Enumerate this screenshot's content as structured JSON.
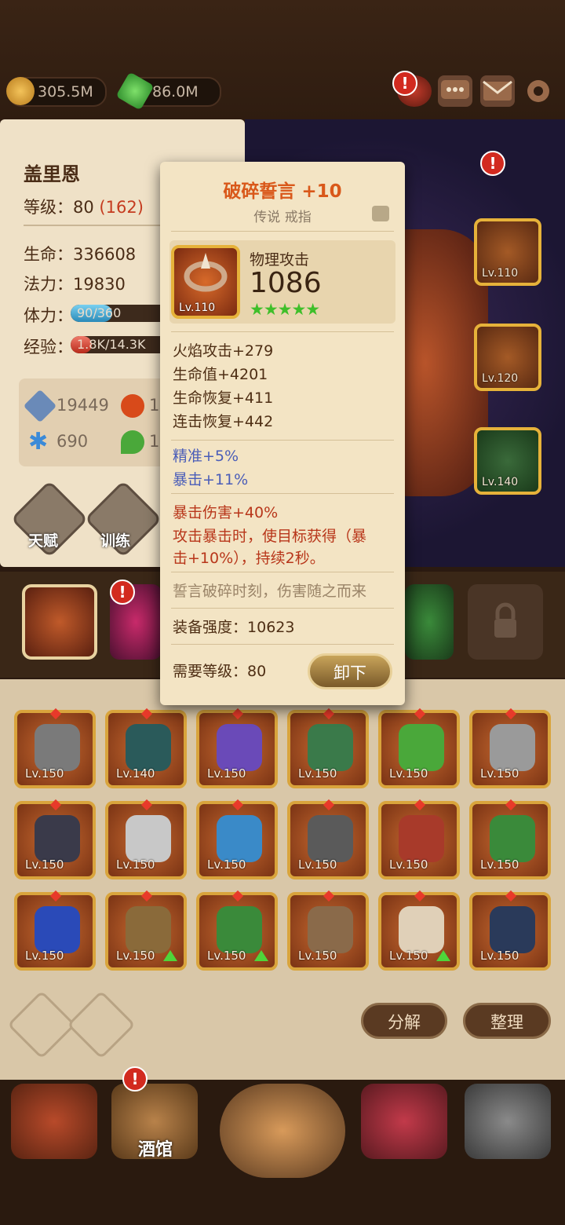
{
  "resources": {
    "coins": "305.5M",
    "gems": "86.0M"
  },
  "hero": {
    "name": "盖里恩",
    "level_label": "等级：",
    "level_value": "80",
    "level_extra": "(162)",
    "hp_label": "生命：",
    "hp_value": "336608",
    "mana_label": "法力：",
    "mana_value": "19830",
    "stamina_label": "体力：",
    "stamina_text": "90/360",
    "stamina_fraction": 0.25,
    "exp_label": "经验：",
    "exp_text": "1.8K/14.3K",
    "exp_fraction": 0.13,
    "attack_value": "19449",
    "attack_value_2": "1",
    "magic_value": "690",
    "magic_value_2": "1",
    "talent_label": "天赋",
    "train_label": "训练"
  },
  "tooltip": {
    "title": "破碎誓言 +10",
    "subtitle": "传说 戒指",
    "main_stat_label": "物理攻击",
    "main_stat_value": "1086",
    "item_level": "Lv.110",
    "stars": 5,
    "stats_brown": [
      "火焰攻击+279",
      "生命值+4201",
      "生命恢复+411",
      "连击恢复+442"
    ],
    "stats_blue": [
      "精准+5%",
      "暴击+11%"
    ],
    "special_1": "暴击伤害+40%",
    "special_2a": "攻击暴击时，使目标获得（暴",
    "special_2b": "击+10%），持续2秒。",
    "flavor": "誓言破碎时刻，伤害随之而来",
    "power_label": "装备强度：",
    "power_value": "10623",
    "req_label": "需要等级：",
    "req_value": "80",
    "unequip_label": "卸下"
  },
  "equipped_slots": [
    "Lv.110",
    "Lv.120",
    "Lv.140"
  ],
  "inventory": [
    "Lv.150",
    "Lv.140",
    "Lv.150",
    "Lv.150",
    "Lv.150",
    "Lv.150",
    "Lv.150",
    "Lv.150",
    "Lv.150",
    "Lv.150",
    "Lv.150",
    "Lv.150",
    "Lv.150",
    "Lv.150",
    "Lv.150",
    "Lv.150",
    "Lv.150",
    "Lv.150"
  ],
  "buttons": {
    "disassemble": "分解",
    "sort": "整理"
  },
  "nav": {
    "tavern_label": "酒馆"
  },
  "colors": {
    "accent_gold": "#e6b23a",
    "alert_red": "#d22a1f",
    "star_green": "#3fbf2a",
    "text_blue": "#4a5db8",
    "text_red": "#b8361a"
  }
}
